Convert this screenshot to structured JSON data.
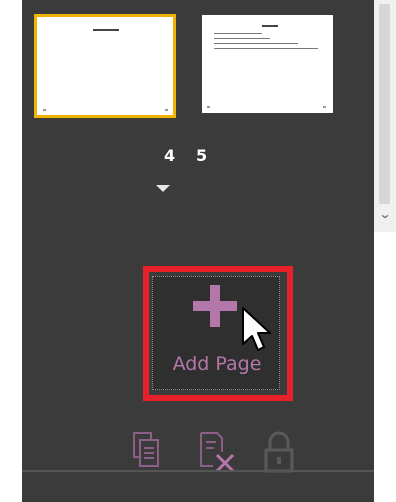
{
  "thumbnails": [
    {
      "page": "4",
      "selected": true
    },
    {
      "page": "5",
      "selected": false
    }
  ],
  "page_numbers": [
    "4",
    "5"
  ],
  "add_page": {
    "label": "Add Page"
  },
  "colors": {
    "panel_bg": "#3b3b3b",
    "accent_purple": "#b377aa",
    "highlight_red": "#e8202a",
    "selection_yellow": "#f0b400"
  },
  "icons": [
    "scroll-down-chevron-icon",
    "expand-triangle-icon",
    "plus-icon",
    "mouse-cursor-icon",
    "copy-page-icon",
    "delete-page-icon",
    "lock-icon"
  ]
}
